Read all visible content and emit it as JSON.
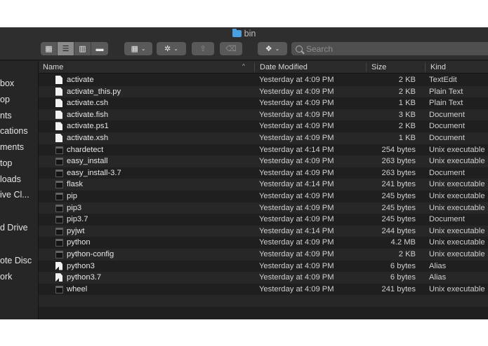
{
  "window": {
    "title": "bin"
  },
  "toolbar": {
    "view_icon": "icon-view-grid",
    "list_icon": "icon-view-list",
    "column_icon": "icon-view-columns",
    "gallery_icon": "icon-view-gallery",
    "group_icon": "icon-group",
    "action_icon": "icon-gear",
    "share_icon": "icon-share",
    "tag_icon": "icon-tag",
    "dropbox_icon": "icon-dropbox",
    "search_placeholder": "Search",
    "grid_glyph": "▦",
    "list_glyph": "☰",
    "columns_glyph": "▥",
    "gallery_glyph": "▬",
    "gear_glyph": "✲",
    "share_glyph": "⇪",
    "tag_glyph": "⌫",
    "dropbox_glyph": "❖",
    "caret_glyph": "⌄"
  },
  "sidebar": {
    "items": [
      "box",
      "op",
      "nts",
      "cations",
      "ments",
      "top",
      "loads",
      "ive Cl...",
      "d Drive",
      "ote Disc",
      "ork"
    ]
  },
  "columns": {
    "name": "Name",
    "date": "Date Modified",
    "size": "Size",
    "kind": "Kind",
    "sort_glyph": "^"
  },
  "files": [
    {
      "name": "activate",
      "date": "Yesterday at 4:09 PM",
      "size": "2 KB",
      "kind": "TextEdit",
      "icon": "doc"
    },
    {
      "name": "activate_this.py",
      "date": "Yesterday at 4:09 PM",
      "size": "2 KB",
      "kind": "Plain Text",
      "icon": "doc"
    },
    {
      "name": "activate.csh",
      "date": "Yesterday at 4:09 PM",
      "size": "1 KB",
      "kind": "Plain Text",
      "icon": "doc"
    },
    {
      "name": "activate.fish",
      "date": "Yesterday at 4:09 PM",
      "size": "3 KB",
      "kind": "Document",
      "icon": "doc"
    },
    {
      "name": "activate.ps1",
      "date": "Yesterday at 4:09 PM",
      "size": "2 KB",
      "kind": "Document",
      "icon": "doc"
    },
    {
      "name": "activate.xsh",
      "date": "Yesterday at 4:09 PM",
      "size": "1 KB",
      "kind": "Document",
      "icon": "doc"
    },
    {
      "name": "chardetect",
      "date": "Yesterday at 4:14 PM",
      "size": "254 bytes",
      "kind": "Unix executable",
      "icon": "exec"
    },
    {
      "name": "easy_install",
      "date": "Yesterday at 4:09 PM",
      "size": "263 bytes",
      "kind": "Unix executable",
      "icon": "exec"
    },
    {
      "name": "easy_install-3.7",
      "date": "Yesterday at 4:09 PM",
      "size": "263 bytes",
      "kind": "Document",
      "icon": "exec"
    },
    {
      "name": "flask",
      "date": "Yesterday at 4:14 PM",
      "size": "241 bytes",
      "kind": "Unix executable",
      "icon": "exec"
    },
    {
      "name": "pip",
      "date": "Yesterday at 4:09 PM",
      "size": "245 bytes",
      "kind": "Unix executable",
      "icon": "exec"
    },
    {
      "name": "pip3",
      "date": "Yesterday at 4:09 PM",
      "size": "245 bytes",
      "kind": "Unix executable",
      "icon": "exec"
    },
    {
      "name": "pip3.7",
      "date": "Yesterday at 4:09 PM",
      "size": "245 bytes",
      "kind": "Document",
      "icon": "exec"
    },
    {
      "name": "pyjwt",
      "date": "Yesterday at 4:14 PM",
      "size": "244 bytes",
      "kind": "Unix executable",
      "icon": "exec"
    },
    {
      "name": "python",
      "date": "Yesterday at 4:09 PM",
      "size": "4.2 MB",
      "kind": "Unix executable",
      "icon": "exec"
    },
    {
      "name": "python-config",
      "date": "Yesterday at 4:09 PM",
      "size": "2 KB",
      "kind": "Unix executable",
      "icon": "exec"
    },
    {
      "name": "python3",
      "date": "Yesterday at 4:09 PM",
      "size": "6 bytes",
      "kind": "Alias",
      "icon": "alias"
    },
    {
      "name": "python3.7",
      "date": "Yesterday at 4:09 PM",
      "size": "6 bytes",
      "kind": "Alias",
      "icon": "alias"
    },
    {
      "name": "wheel",
      "date": "Yesterday at 4:09 PM",
      "size": "241 bytes",
      "kind": "Unix executable",
      "icon": "exec"
    }
  ]
}
